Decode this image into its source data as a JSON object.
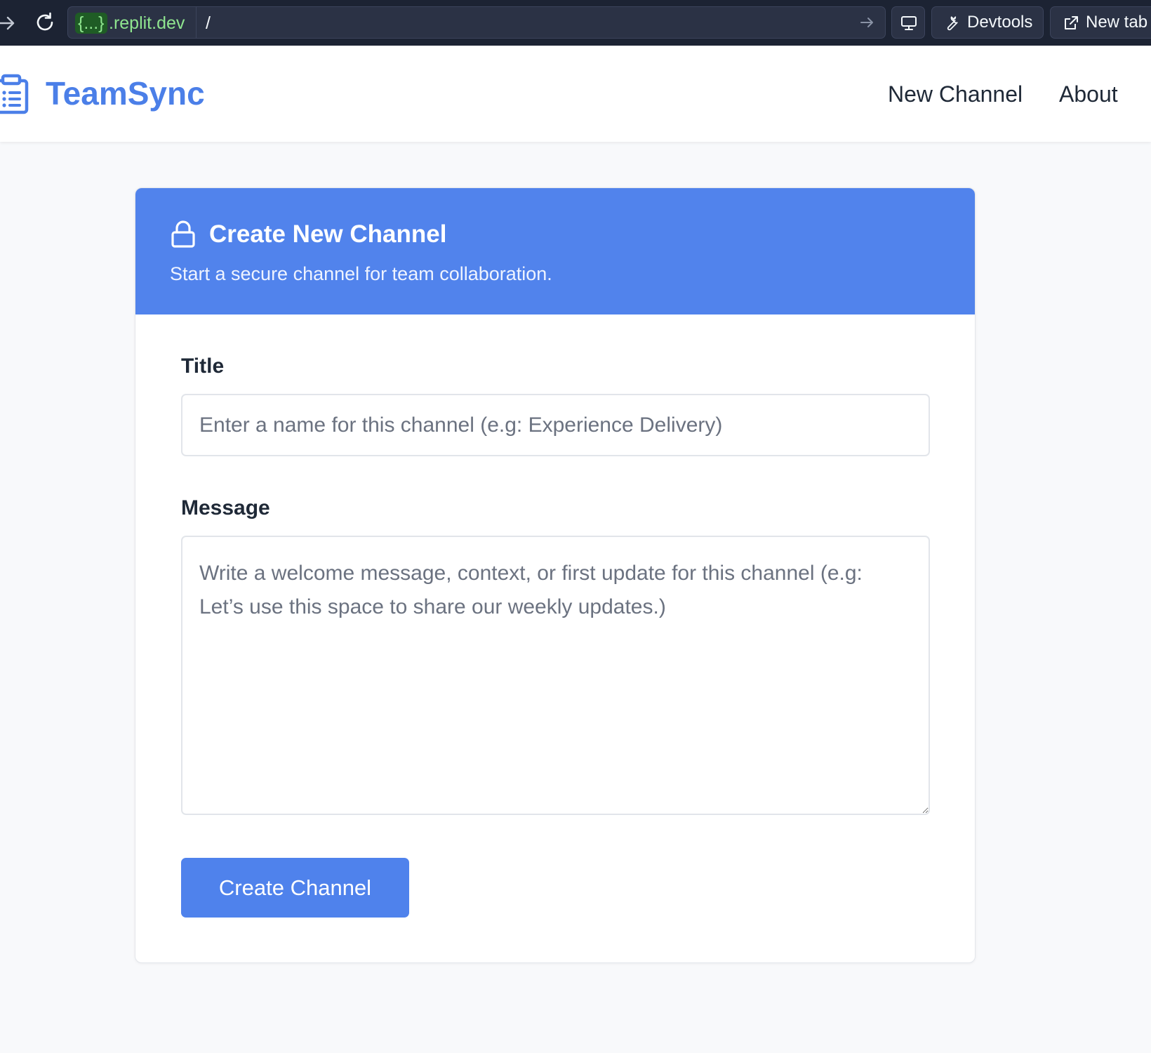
{
  "browser": {
    "url_badge": "{...}",
    "url_domain": ".replit.dev",
    "url_path": "/",
    "devtools_label": "Devtools",
    "new_tab_label": "New tab"
  },
  "header": {
    "brand": "TeamSync",
    "nav": {
      "new_channel": "New Channel",
      "about": "About"
    }
  },
  "card": {
    "title": "Create New Channel",
    "subtitle": "Start a secure channel for team collaboration.",
    "title_field": {
      "label": "Title",
      "value": "",
      "placeholder": "Enter a name for this channel (e.g: Experience Delivery)"
    },
    "message_field": {
      "label": "Message",
      "value": "",
      "placeholder": "Write a welcome message, context, or first update for this channel (e.g: Let’s use this space to share our weekly updates.)"
    },
    "submit_label": "Create Channel"
  },
  "colors": {
    "brand": "#4b7fe8",
    "card_header": "#5183ec",
    "button": "#4f82ec",
    "chrome_bg": "#1c2333",
    "url_green": "#8fe58f"
  },
  "icons": {
    "logo": "clipboard-list-icon",
    "card": "lock-icon",
    "forward": "arrow-right-icon",
    "reload": "reload-icon",
    "screen": "monitor-icon",
    "devtools": "wrench-icon",
    "new_tab": "external-link-icon"
  }
}
